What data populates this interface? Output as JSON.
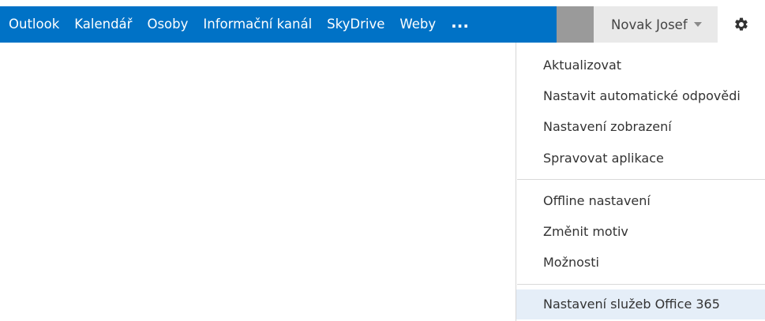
{
  "nav": {
    "items": [
      {
        "label": "Outlook"
      },
      {
        "label": "Kalendář"
      },
      {
        "label": "Osoby"
      },
      {
        "label": "Informační kanál"
      },
      {
        "label": "SkyDrive"
      },
      {
        "label": "Weby"
      }
    ],
    "more_label": "...",
    "bar_color": "#0072c6"
  },
  "user": {
    "name": "Novak Josef",
    "caret_icon": "caret-down-icon"
  },
  "settings": {
    "icon": "gear-icon"
  },
  "menu": {
    "group1": [
      {
        "label": "Aktualizovat"
      },
      {
        "label": "Nastavit automatické odpovědi"
      },
      {
        "label": "Nastavení zobrazení"
      },
      {
        "label": "Spravovat aplikace"
      }
    ],
    "group2": [
      {
        "label": "Offline nastavení"
      },
      {
        "label": "Změnit motiv"
      },
      {
        "label": "Možnosti"
      }
    ],
    "group3": [
      {
        "label": "Nastavení služeb Office 365",
        "highlighted": true
      }
    ],
    "highlight_color": "#e5eef8"
  }
}
